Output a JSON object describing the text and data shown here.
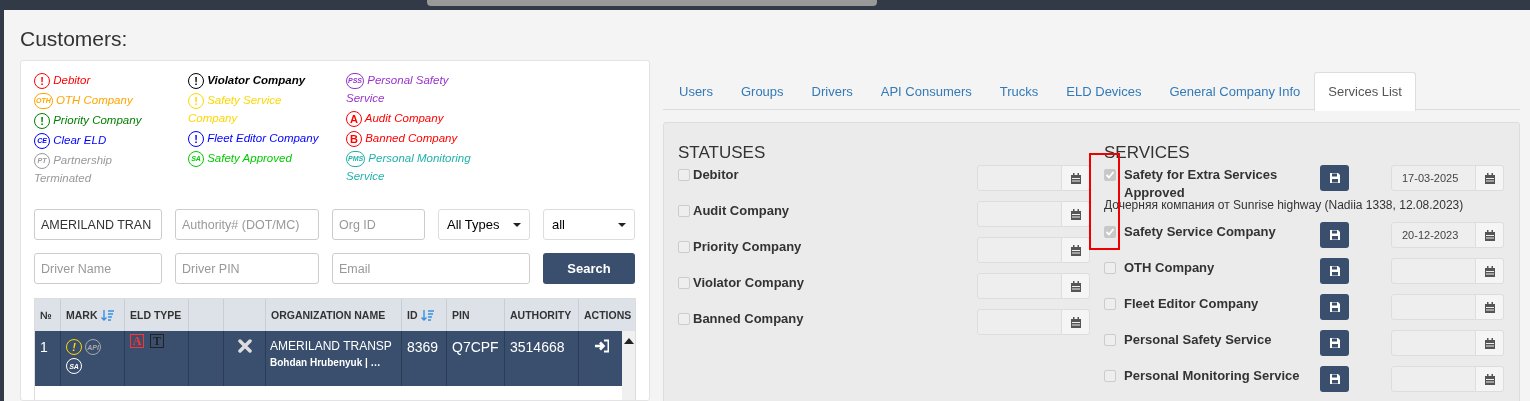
{
  "page_title": "Customers:",
  "legend": [
    {
      "badge": "!",
      "label": "Debitor",
      "color": "#ff0000"
    },
    {
      "badge": "OTH",
      "label": "OTH Company",
      "color": "#ffa500"
    },
    {
      "badge": "!",
      "label": "Priority Company",
      "color": "#008000"
    },
    {
      "badge": "CE",
      "label": "Clear ELD",
      "color": "#0000ff"
    },
    {
      "badge": "PT",
      "label": "Partnership Terminated",
      "color": "#999999"
    },
    {
      "badge": "!",
      "label": "Violator Company",
      "color": "#000000"
    },
    {
      "badge": "!",
      "label": "Safety Service Company",
      "color": "#ffd700"
    },
    {
      "badge": "!",
      "label": "Fleet Editor Company",
      "color": "#0000ff"
    },
    {
      "badge": "SA",
      "label": "Safety Approved",
      "color": "#00cc00"
    },
    {
      "badge": "PSS",
      "label": "Personal Safety Service",
      "color": "#9932cc"
    },
    {
      "badge": "A",
      "label": "Audit Company",
      "color": "#ff0000"
    },
    {
      "badge": "B",
      "label": "Banned Company",
      "color": "#ff0000"
    },
    {
      "badge": "PMS",
      "label": "Personal Monitoring Service",
      "color": "#20b2aa"
    }
  ],
  "filters": [
    {
      "kind": "input",
      "value": "AMERILAND TRAN"
    },
    {
      "kind": "input",
      "placeholder": "Authority# (DOT/MC)"
    },
    {
      "kind": "input",
      "placeholder": "Org ID"
    },
    {
      "kind": "select",
      "value": "All Types"
    },
    {
      "kind": "select",
      "value": "all"
    },
    {
      "kind": "input",
      "placeholder": "Driver Name"
    },
    {
      "kind": "input",
      "placeholder": "Driver PIN"
    },
    {
      "kind": "input",
      "placeholder": "Email",
      "wide": true
    },
    {
      "kind": "button",
      "label": "Search"
    }
  ],
  "table": {
    "columns": [
      {
        "label": "№"
      },
      {
        "label": "MARK",
        "sortable": true
      },
      {
        "label": "ELD TYPE"
      },
      {},
      {},
      {
        "label": "ORGANIZATION NAME"
      },
      {
        "label": "ID",
        "sortable": true
      },
      {
        "label": "PIN"
      },
      {
        "label": "AUTHORITY"
      },
      {
        "label": "ACTIONS"
      }
    ],
    "rows": [
      {
        "selected": true,
        "number": "1",
        "marks": [
          {
            "text": "!",
            "color": "#ffd700"
          },
          {
            "text": "API",
            "color": "#aaaaaa"
          },
          {
            "text": "SA",
            "color": "#ffffff"
          }
        ],
        "eld_types": [
          {
            "text": "A",
            "color": "#ff3333"
          },
          {
            "text": "T",
            "color": "#222222"
          }
        ],
        "org_name": "AMERILAND TRANSP",
        "org_sub": "Bohdan Hrubenyuk | …",
        "id": "8369",
        "pin": "Q7CPF",
        "authority": "3514668"
      }
    ]
  },
  "tabs": [
    {
      "label": "Users",
      "selected": false
    },
    {
      "label": "Groups",
      "selected": false
    },
    {
      "label": "Drivers",
      "selected": false
    },
    {
      "label": "API Consumers",
      "selected": false
    },
    {
      "label": "Trucks",
      "selected": false
    },
    {
      "label": "ELD Devices",
      "selected": false
    },
    {
      "label": "General Company Info",
      "selected": false
    },
    {
      "label": "Services List",
      "selected": true
    }
  ],
  "statuses": {
    "title": "STATUSES",
    "items": [
      {
        "label": "Debitor",
        "checked": false
      },
      {
        "label": "Audit Company",
        "checked": false
      },
      {
        "label": "Priority Company",
        "checked": false
      },
      {
        "label": "Violator Company",
        "checked": false
      },
      {
        "label": "Banned Company",
        "checked": false
      }
    ]
  },
  "services": {
    "title": "SERVICES",
    "items": [
      {
        "label": "Safety for Extra Services Approved",
        "checked": true,
        "date": "17-03-2025",
        "note": "Дочерняя компания от Sunrise highway (Nadiia 1338, 12.08.2023)"
      },
      {
        "label": "Safety Service Company",
        "checked": true,
        "date": "20-12-2023"
      },
      {
        "label": "OTH Company",
        "checked": false
      },
      {
        "label": "Fleet Editor Company",
        "checked": false
      },
      {
        "label": "Personal Safety Service",
        "checked": false
      },
      {
        "label": "Personal Monitoring Service",
        "checked": false
      }
    ]
  }
}
